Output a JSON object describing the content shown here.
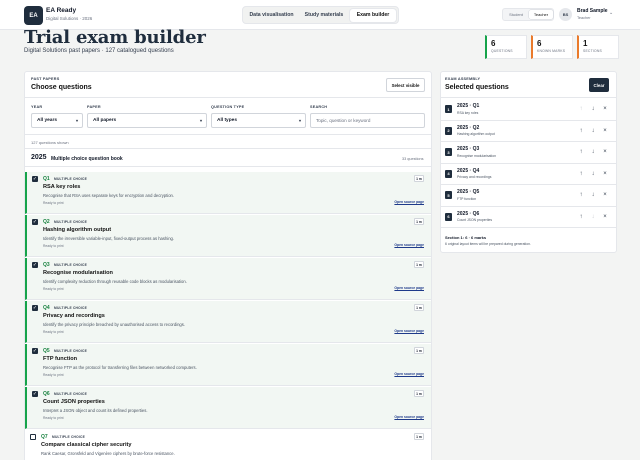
{
  "app": {
    "logo_text": "EA",
    "name": "EA Ready",
    "subtitle": "Digital Solutions · 2026"
  },
  "nav": {
    "tabs": [
      {
        "label": "Data visualisation",
        "active": false
      },
      {
        "label": "Study materials",
        "active": false
      },
      {
        "label": "Exam builder",
        "active": true
      }
    ]
  },
  "role_toggle": {
    "options": [
      {
        "label": "Student",
        "active": false
      },
      {
        "label": "Teacher",
        "active": true
      }
    ]
  },
  "user": {
    "initials": "BS",
    "name": "Brad Sample",
    "role": "Teacher",
    "chevron_icon": "chevron-down-icon"
  },
  "header": {
    "title": "Trial exam builder",
    "subtitle": "Digital Solutions past papers · 127 catalogued questions"
  },
  "stats": [
    {
      "value": "6",
      "label": "QUESTIONS"
    },
    {
      "value": "6",
      "label": "KNOWN MARKS"
    },
    {
      "value": "1",
      "label": "SECTIONS"
    }
  ],
  "colors": {
    "accent_green": "#16a34a",
    "dark_navy": "#1f2d3d",
    "selected_row_bg": "#f2f7f3",
    "link_blue": "#1e3a8a"
  },
  "past_papers": {
    "eyebrow": "PAST PAPERS",
    "title": "Choose questions",
    "select_visible_label": "Select visible",
    "filters": {
      "year": {
        "label": "YEAR",
        "value": "All years"
      },
      "paper": {
        "label": "PAPER",
        "value": "All papers"
      },
      "question_type": {
        "label": "QUESTION TYPE",
        "value": "All types"
      },
      "search": {
        "label": "SEARCH",
        "placeholder": "Topic, question or keyword"
      }
    },
    "shown_count": "127 questions shown",
    "group": {
      "year": "2025",
      "title": "Multiple choice question book",
      "count": "33 questions"
    },
    "ready_label": "Ready to print",
    "open_source_label": "Open source page",
    "questions": [
      {
        "id": "Q1",
        "type": "MULTIPLE CHOICE",
        "title": "RSA key roles",
        "description": "Recognise that RSA uses separate keys for encryption and decryption.",
        "marks": "1 m",
        "selected": true
      },
      {
        "id": "Q2",
        "type": "MULTIPLE CHOICE",
        "title": "Hashing algorithm output",
        "description": "Identify the irreversible variable-input, fixed-output process as hashing.",
        "marks": "1 m",
        "selected": true
      },
      {
        "id": "Q3",
        "type": "MULTIPLE CHOICE",
        "title": "Recognise modularisation",
        "description": "Identify complexity reduction through reusable code blocks as modularisation.",
        "marks": "1 m",
        "selected": true
      },
      {
        "id": "Q4",
        "type": "MULTIPLE CHOICE",
        "title": "Privacy and recordings",
        "description": "Identify the privacy principle breached by unauthorised access to recordings.",
        "marks": "1 m",
        "selected": true
      },
      {
        "id": "Q5",
        "type": "MULTIPLE CHOICE",
        "title": "FTP function",
        "description": "Recognise FTP as the protocol for transferring files between networked computers.",
        "marks": "1 m",
        "selected": true
      },
      {
        "id": "Q6",
        "type": "MULTIPLE CHOICE",
        "title": "Count JSON properties",
        "description": "Interpret a JSON object and count its defined properties.",
        "marks": "1 m",
        "selected": true
      },
      {
        "id": "Q7",
        "type": "MULTIPLE CHOICE",
        "title": "Compare classical cipher security",
        "description": "Rank Caesar, Gronsfeld and Vigenère ciphers by brute-force resistance.",
        "marks": "1 m",
        "selected": false
      }
    ]
  },
  "assembly": {
    "eyebrow": "EXAM ASSEMBLY",
    "title": "Selected questions",
    "clear_label": "Clear",
    "items": [
      {
        "num": "1",
        "id": "2025 · Q1",
        "title": "RSA key roles",
        "up_disabled": true,
        "down_disabled": false
      },
      {
        "num": "2",
        "id": "2025 · Q2",
        "title": "Hashing algorithm output",
        "up_disabled": false,
        "down_disabled": false
      },
      {
        "num": "3",
        "id": "2025 · Q3",
        "title": "Recognise modularisation",
        "up_disabled": false,
        "down_disabled": false
      },
      {
        "num": "4",
        "id": "2025 · Q4",
        "title": "Privacy and recordings",
        "up_disabled": false,
        "down_disabled": false
      },
      {
        "num": "5",
        "id": "2025 · Q5",
        "title": "FTP function",
        "up_disabled": false,
        "down_disabled": false
      },
      {
        "num": "6",
        "id": "2025 · Q6",
        "title": "Count JSON properties",
        "up_disabled": false,
        "down_disabled": true
      }
    ],
    "section_total": "Section 1: 6 · 6 marks",
    "section_note": "6 original layout items will be prepared during generation."
  }
}
